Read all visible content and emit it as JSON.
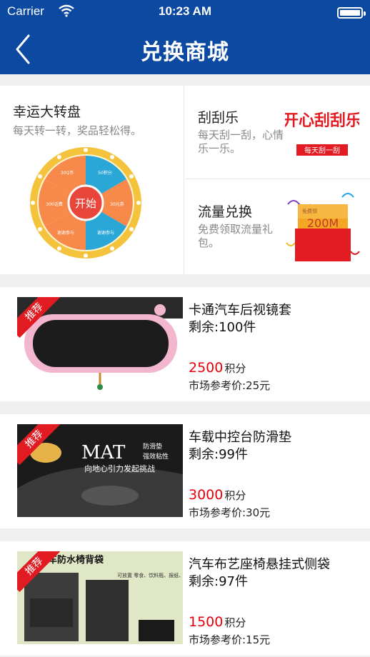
{
  "status_bar": {
    "carrier": "Carrier",
    "time": "10:23 AM"
  },
  "nav": {
    "title": "兑换商城"
  },
  "wheel": {
    "title": "幸运大转盘",
    "subtitle": "每天转一转，奖品轻松得。",
    "center": "开始",
    "prizes": [
      "50积分",
      "30元券",
      "谢谢参与",
      "谢谢参与",
      "300话费",
      "30Q币"
    ]
  },
  "scratch": {
    "title": "刮刮乐",
    "subtitle": "每天刮一刮，心情乐一乐。",
    "banner": "开心刮刮乐",
    "slogan": "每天刮一刮"
  },
  "traffic": {
    "title": "流量兑换",
    "subtitle": "免费领取流量礼包。",
    "amount": "200M",
    "tag": "免费领"
  },
  "products": [
    {
      "badge": "推荐",
      "name": "卡通汽车后视镜套",
      "stock": "剩余:100件",
      "points": "2500",
      "points_unit": "积分",
      "market_price": "市场参考价:25元"
    },
    {
      "badge": "推荐",
      "name": "车载中控台防滑垫",
      "stock": "剩余:99件",
      "points": "3000",
      "points_unit": "积分",
      "market_price": "市场参考价:30元",
      "image_text": {
        "big": "MAT",
        "tag1": "防滑垫",
        "tag2": "强效粘性",
        "line": "向地心引力发起挑战"
      }
    },
    {
      "badge": "推荐",
      "name": "汽车布艺座椅悬挂式侧袋",
      "stock": "剩余:97件",
      "points": "1500",
      "points_unit": "积分",
      "market_price": "市场参考价:15元",
      "image_text": {
        "title": "汽车防水椅背袋",
        "note": "可放置 零食、饮料瓶、报纸、杂物..."
      }
    }
  ]
}
